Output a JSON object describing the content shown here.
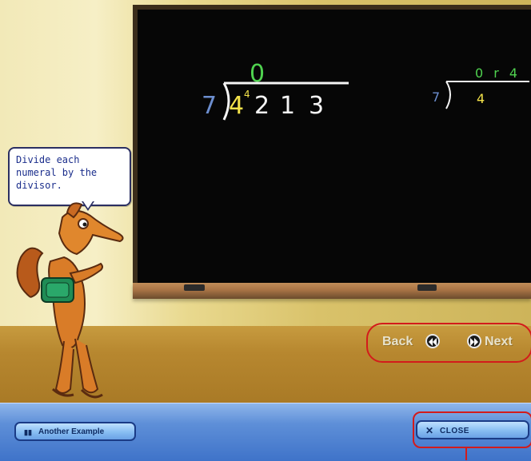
{
  "chalkboard": {
    "left_problem": {
      "quotient": "0",
      "divisor": "7",
      "dividend_digits": [
        "4",
        "2",
        "1",
        "3"
      ],
      "carry_superscript": "4"
    },
    "right_problem": {
      "quotient_line": "0 r 4",
      "divisor": "7",
      "dividend": "4"
    }
  },
  "speech_bubble": {
    "text": "Divide each numeral by the divisor."
  },
  "navigation": {
    "back_label": "Back",
    "next_label": "Next"
  },
  "buttons": {
    "another_example_label": "Another Example",
    "close_label": "CLOSE"
  }
}
